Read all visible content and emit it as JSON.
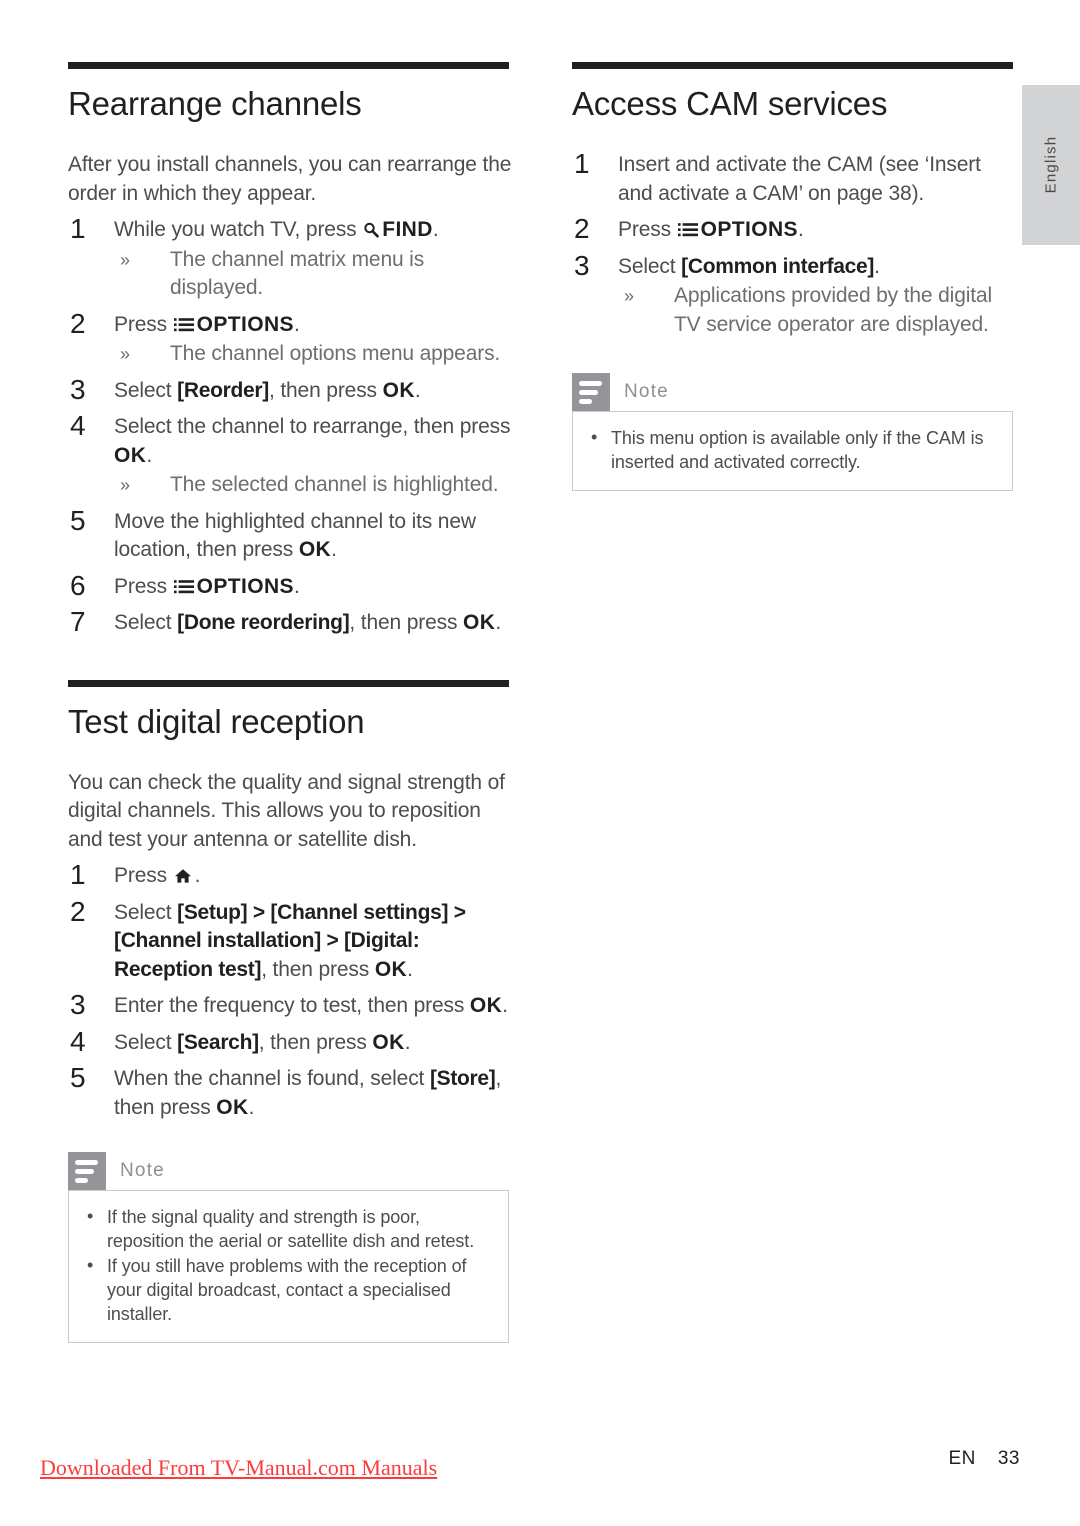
{
  "page": {
    "language_tab": "English",
    "footer_watermark": "Downloaded From TV-Manual.com Manuals",
    "footer_locale": "EN",
    "footer_page_number": "33"
  },
  "left_column": {
    "sections": [
      {
        "title": "Rearrange channels",
        "intro": "After you install channels, you can rearrange the order in which they appear.",
        "steps": [
          {
            "num": "1",
            "text_before": "While you watch TV, press",
            "icon": "search-icon",
            "key": "FIND",
            "text_after": ".",
            "results": [
              "The channel matrix menu is displayed."
            ]
          },
          {
            "num": "2",
            "text_before": "Press",
            "icon": "options-icon",
            "key": "OPTIONS",
            "text_after": ".",
            "results": [
              "The channel options menu appears."
            ]
          },
          {
            "num": "3",
            "text_before": "Select",
            "menu": "[Reorder]",
            "text_mid": ", then press",
            "key": "OK",
            "text_after": ".",
            "results": []
          },
          {
            "num": "4",
            "text_before": "Select the channel to rearrange, then press",
            "key": "OK",
            "text_after": ".",
            "results": [
              "The selected channel is highlighted."
            ]
          },
          {
            "num": "5",
            "text_before": "Move the highlighted channel to its new location, then press",
            "key": "OK",
            "text_after": ".",
            "results": []
          },
          {
            "num": "6",
            "text_before": "Press",
            "icon": "options-icon",
            "key": "OPTIONS",
            "text_after": ".",
            "results": []
          },
          {
            "num": "7",
            "text_before": "Select",
            "menu": "[Done reordering]",
            "text_mid": ", then press",
            "key": "OK",
            "text_after": ".",
            "results": []
          }
        ]
      },
      {
        "title": "Test digital reception",
        "intro": "You can check the quality and signal strength of digital channels. This allows you to reposition and test your antenna or satellite dish.",
        "steps": [
          {
            "num": "1",
            "text_before": "Press",
            "icon": "home-icon",
            "text_after": ".",
            "results": []
          },
          {
            "num": "2",
            "text_before": "Select",
            "path": "[Setup] > [Channel settings] > [Channel installation] > [Digital: Reception test]",
            "text_mid": ", then press",
            "key": "OK",
            "text_after": ".",
            "results": []
          },
          {
            "num": "3",
            "text_before": "Enter the frequency to test, then press",
            "key": "OK",
            "text_after": ".",
            "results": []
          },
          {
            "num": "4",
            "text_before": "Select",
            "menu": "[Search]",
            "text_mid": ", then press",
            "key": "OK",
            "text_after": ".",
            "results": []
          },
          {
            "num": "5",
            "text_before": "When the channel is found, select",
            "menu": "[Store]",
            "text_mid": ", then press",
            "key": "OK",
            "text_after": ".",
            "results": []
          }
        ],
        "note": {
          "title": "Note",
          "items": [
            "If the signal quality and strength is poor, reposition the aerial or satellite dish and retest.",
            "If you still have problems with the reception of your digital broadcast, contact a specialised installer."
          ]
        }
      }
    ]
  },
  "right_column": {
    "sections": [
      {
        "title": "Access CAM services",
        "steps": [
          {
            "num": "1",
            "text_before": "Insert and activate the CAM (see ‘Insert and activate a CAM’ on page 38).",
            "results": []
          },
          {
            "num": "2",
            "text_before": "Press",
            "icon": "options-icon",
            "key": "OPTIONS",
            "text_after": ".",
            "results": []
          },
          {
            "num": "3",
            "text_before": "Select",
            "menu": "[Common interface]",
            "text_after": ".",
            "results": [
              "Applications provided by the digital TV service operator are displayed."
            ]
          }
        ],
        "note": {
          "title": "Note",
          "items": [
            "This menu option is available only if the CAM is inserted and activated correctly."
          ]
        }
      }
    ]
  },
  "colors": {
    "rule": "#231f20",
    "body_text": "#4d4d4f",
    "note_badge": "#939598",
    "note_border": "#c9cacc",
    "lang_tab_bg": "#d2d3d5",
    "watermark": "#fa3c3c"
  }
}
